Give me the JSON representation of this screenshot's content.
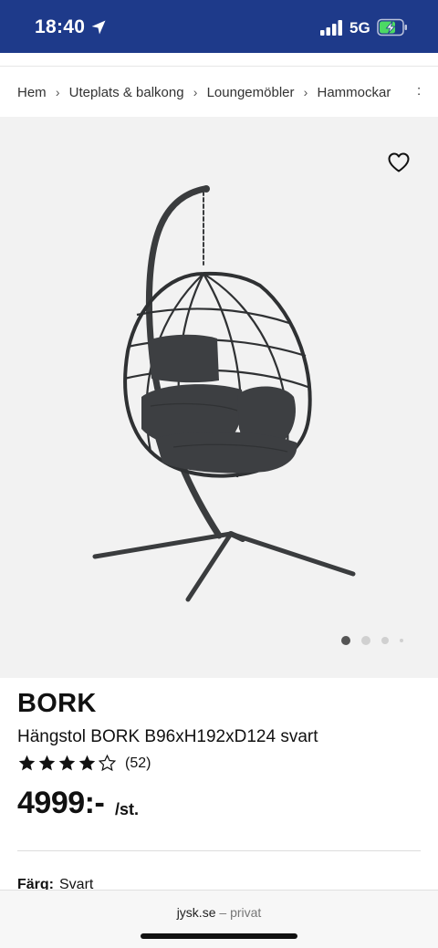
{
  "status_bar": {
    "time": "18:40",
    "network": "5G",
    "background_color": "#1e3a8a"
  },
  "breadcrumb": {
    "items": [
      "Hem",
      "Uteplats & balkong",
      "Loungemöbler",
      "Hammockar"
    ],
    "separator": "›",
    "more": ":"
  },
  "product": {
    "brand": "BORK",
    "name": "Hängstol BORK B96xH192xD124 svart",
    "rating": 4,
    "rating_max": 5,
    "review_count": "(52)",
    "price": "4999:-",
    "price_unit": "/st.",
    "color_label": "Färg:",
    "color_value": "Svart",
    "image_count": 4,
    "active_image": 1
  },
  "icons": {
    "favorite": "heart-icon",
    "location": "location-arrow-icon",
    "signal": "signal-icon",
    "battery": "battery-charging-icon",
    "star_filled": "star-filled-icon",
    "star_empty": "star-outline-icon"
  },
  "browser": {
    "domain": "jysk.se",
    "separator": "–",
    "mode": "privat"
  }
}
